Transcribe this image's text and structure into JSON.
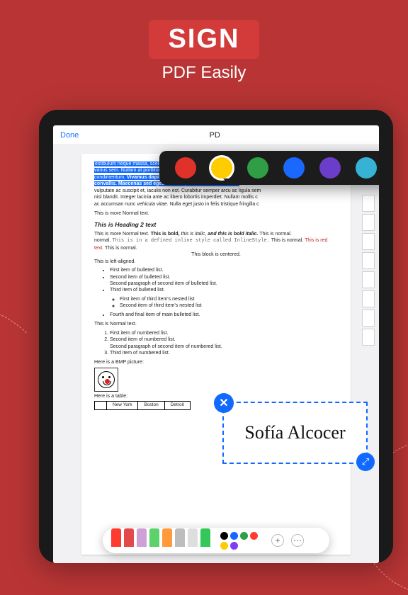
{
  "hero": {
    "title": "SIGN",
    "subtitle": "PDF Easily"
  },
  "topbar": {
    "done": "Done",
    "title": "PD"
  },
  "palette": [
    "#e0322a",
    "#ffcc00",
    "#2f9e44",
    "#1b68ff",
    "#6a3ec8",
    "#36b3d4",
    "#d9d9d9"
  ],
  "selectedSwatch": 1,
  "doc": {
    "para1_a": "estibulum neque massa, scelerisque sit amet ligula eu, congue molestie n",
    "para1_b": "varius sem. Nullam at porttitor arcu, nec lacinia nisi. Ut ac dolor vitae ",
    "para1_c": "condimentum. ",
    "para1_bold": "Vivamus dapibus sodales ex, vitae malesuada i",
    "para1_d": "convallis. Maecenas sed egestas nulla, ac condimentum orci.",
    "para1_e": " Mae",
    "para1_f": "vulputate ac suscipit et, iaculis non est. Curabitur semper arcu ac ligula sem",
    "para1_g": "nisl blandit. Integer lacinia ante ac libero lobortis imperdiet. Nullam mollis c",
    "para1_h": "ac accumsan nunc ",
    "para1_h_it": "vehicula vitae.",
    "para1_i": " Nulla eget justo in felis tristique fringilla c",
    "normal1": "This is more Normal text.",
    "heading2": "This is Heading 2 text",
    "mix_a": "This is more Normal text. ",
    "mix_b": "This is bold, ",
    "mix_c": "this is italic, ",
    "mix_d": "and this is bold italic.",
    "mix_e": " This is normal. ",
    "code": "This is in a defined inline style called InlineStyle.",
    "mix_f": " This is normal. ",
    "mix_red": "This is red text.",
    "mix_g": " This is normal.",
    "centered": "This block is centered.",
    "left": "This is left-aligned.",
    "b1": "First item of bulleted list.",
    "b2": "Second item of bulleted list.",
    "b2p": "Second paragraph of second item of bulleted list.",
    "b3": "Third item of bulleted list.",
    "b3a": "First item of third item's nested list",
    "b3b": "Second item of third item's nested list",
    "b4": "Fourth and final item of main bulleted list.",
    "normal2": "This is Normal text.",
    "n1": "First item of numbered list.",
    "n2": "Second item of numbered list.",
    "n2p": "Second paragraph of second item of numbered list.",
    "n3": "Third item of numbered list.",
    "bmp": "Here is a BMP picture:",
    "tablelbl": "Here is a table:",
    "tcells": [
      "",
      "New York",
      "Boston",
      "Detroit"
    ]
  },
  "signature": "Sofía Alcocer",
  "toolbar": {
    "tools": [
      "#ff3b30",
      "#e24a4a",
      "#cfa0d6",
      "#5bd26b",
      "#ff9a3b",
      "#bdbdbd",
      "#dedede",
      "#34c759"
    ],
    "colors": [
      "#000000",
      "#1169ff",
      "#2f9e44",
      "#ff3b30",
      "#ffcc00",
      "#7e3ff2"
    ]
  }
}
